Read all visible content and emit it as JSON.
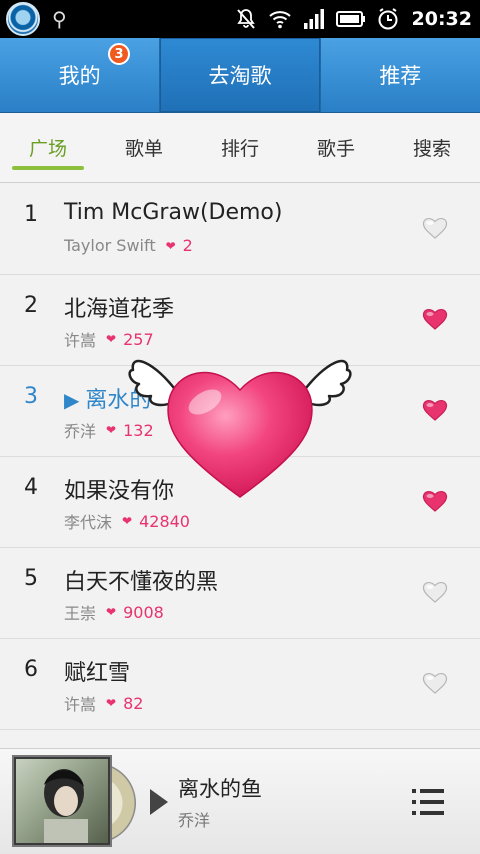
{
  "status_bar": {
    "time": "20:32"
  },
  "top_tabs": [
    {
      "label": "我的",
      "badge": "3"
    },
    {
      "label": "去淘歌"
    },
    {
      "label": "推荐"
    }
  ],
  "sub_tabs": [
    {
      "label": "广场"
    },
    {
      "label": "歌单"
    },
    {
      "label": "排行"
    },
    {
      "label": "歌手"
    },
    {
      "label": "搜索"
    }
  ],
  "songs": [
    {
      "rank": "1",
      "title": "Tim McGraw(Demo)",
      "artist": "Taylor Swift",
      "likes": "2",
      "liked": false
    },
    {
      "rank": "2",
      "title": "北海道花季",
      "artist": "许嵩",
      "likes": "257",
      "liked": true
    },
    {
      "rank": "3",
      "title": "离水的",
      "artist": "乔洋",
      "likes": "132",
      "liked": true,
      "playing": true
    },
    {
      "rank": "4",
      "title": "如果没有你",
      "artist": "李代沫",
      "likes": "42840",
      "liked": true
    },
    {
      "rank": "5",
      "title": "白天不懂夜的黑",
      "artist": "王崇",
      "likes": "9008",
      "liked": false
    },
    {
      "rank": "6",
      "title": "赋红雪",
      "artist": "许嵩",
      "likes": "82",
      "liked": false
    }
  ],
  "player": {
    "title": "离水的鱼",
    "artist": "乔洋"
  },
  "colors": {
    "accent_blue": "#2f86c9",
    "like_pink": "#e8336e",
    "subtab_green": "#8cbf3b"
  }
}
